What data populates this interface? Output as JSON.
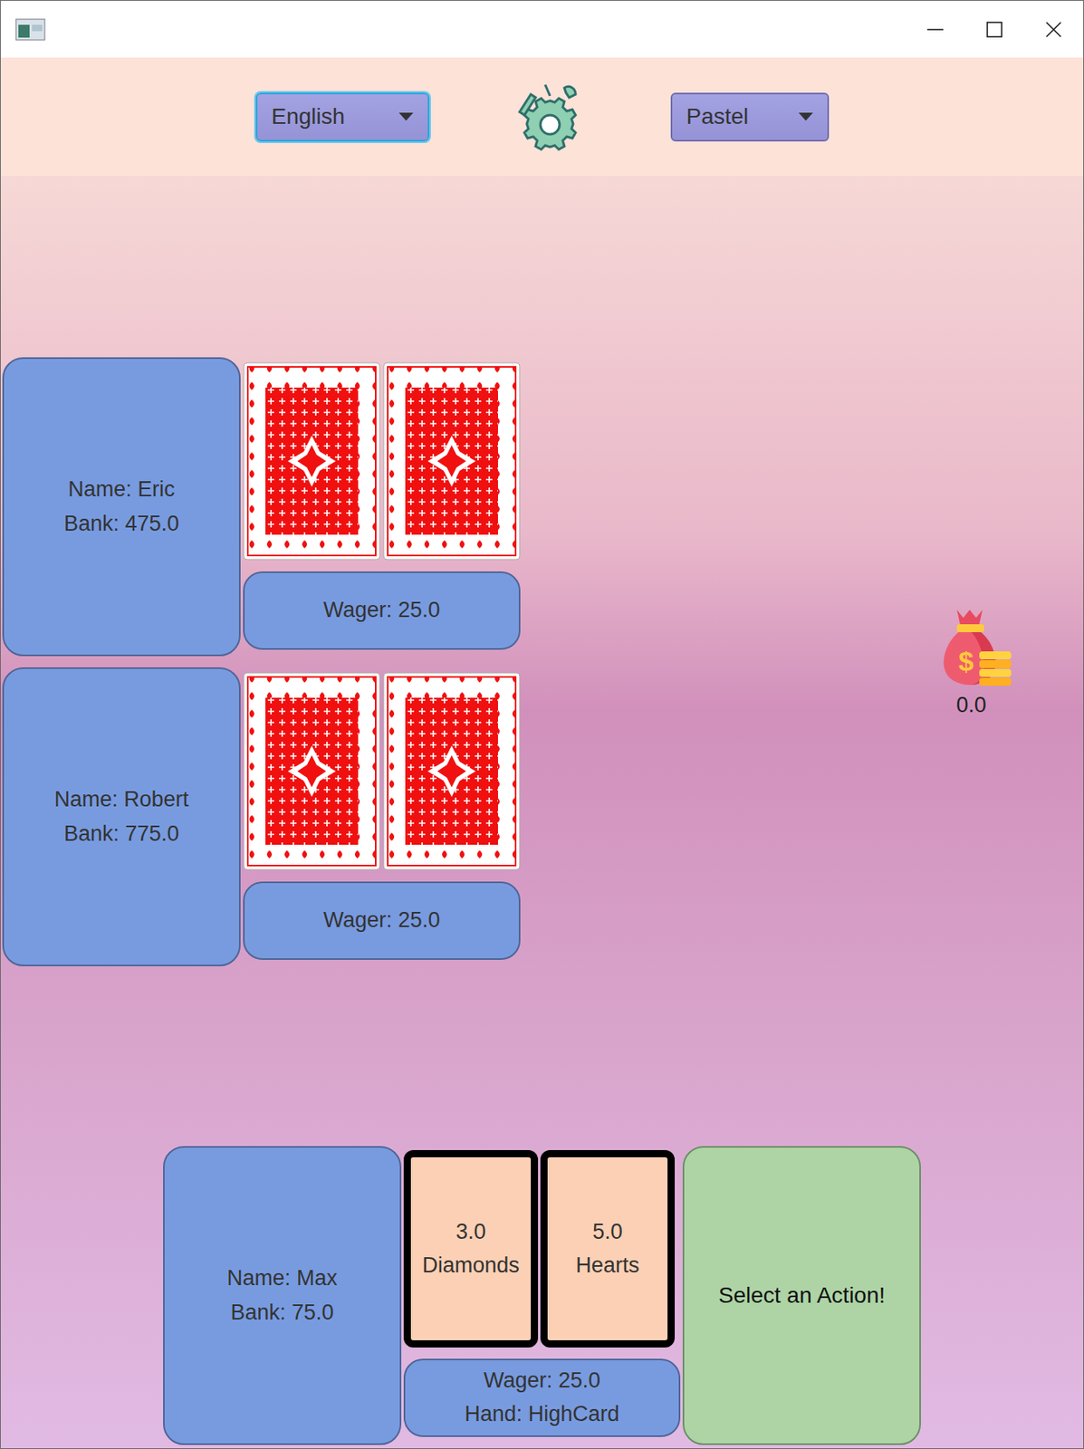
{
  "window": {
    "title": ""
  },
  "toolbar": {
    "language": {
      "value": "English",
      "focused": true
    },
    "theme": {
      "value": "Pastel",
      "focused": false
    }
  },
  "opponents": [
    {
      "name": "Name: Eric",
      "bank": "Bank: 475.0",
      "wager": "Wager: 25.0",
      "cards": [
        {
          "face_up": false
        },
        {
          "face_up": false
        }
      ]
    },
    {
      "name": "Name: Robert",
      "bank": "Bank: 775.0",
      "wager": "Wager: 25.0",
      "cards": [
        {
          "face_up": false
        },
        {
          "face_up": false
        }
      ]
    }
  ],
  "pot": {
    "amount": "0.0"
  },
  "player": {
    "name": "Name: Max",
    "bank": "Bank: 75.0",
    "wager": "Wager: 25.0",
    "hand": "Hand: HighCard",
    "cards": [
      {
        "rank": "3.0",
        "suit": "Diamonds",
        "face_up": true
      },
      {
        "rank": "5.0",
        "suit": "Hearts",
        "face_up": true
      }
    ],
    "action": "Select an Action!"
  }
}
